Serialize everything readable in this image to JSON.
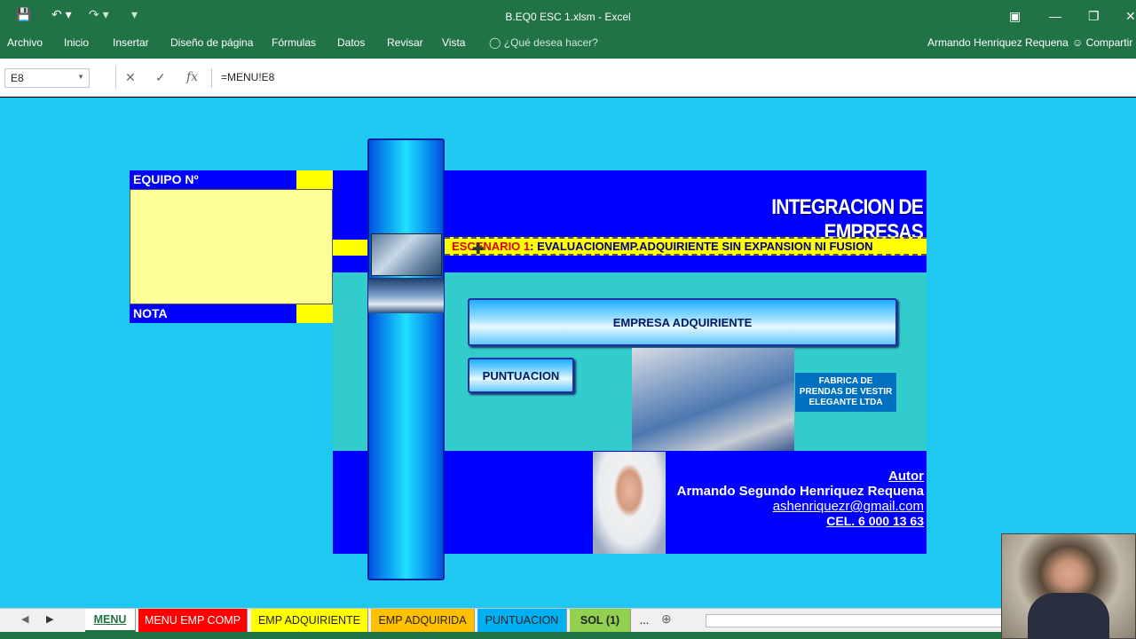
{
  "window": {
    "title": "B.EQ0 ESC 1.xlsm - Excel",
    "user": "Armando Henriquez Requena",
    "share": "Compartir"
  },
  "ribbon": {
    "tabs": [
      "Archivo",
      "Inicio",
      "Insertar",
      "Diseño de página",
      "Fórmulas",
      "Datos",
      "Revisar",
      "Vista"
    ],
    "tell_me": "¿Qué desea hacer?"
  },
  "formula_bar": {
    "name_box": "E8",
    "formula": "=MENU!E8"
  },
  "sheet": {
    "team_label": "EQUIPO Nº",
    "note_label": "NOTA",
    "title": "INTEGRACION DE EMPRESAS",
    "scenario_prefix": "ESCENARIO 1",
    "scenario_text": ": EVALUACIONEMP.ADQUIRIENTE SIN EXPANSION NI FUSION",
    "btn_empresa": "EMPRESA ADQUIRIENTE",
    "btn_puntuacion": "PUNTUACION",
    "factory_label": "FABRICA DE PRENDAS DE VESTIR ELEGANTE LTDA",
    "author_label": "Autor",
    "author_name": "Armando Segundo Henriquez Requena",
    "author_email": "ashenriquezr@gmail.com",
    "author_cel": "CEL. 6  000 13 63"
  },
  "sheet_tabs": [
    {
      "label": "MENU",
      "color": "#ffffff"
    },
    {
      "label": "MENU EMP COMP",
      "color": "#ff0000"
    },
    {
      "label": "EMP ADQUIRIENTE",
      "color": "#ffff00"
    },
    {
      "label": "EMP ADQUIRIDA",
      "color": "#ffc000"
    },
    {
      "label": "PUNTUACION",
      "color": "#00b0f0"
    },
    {
      "label": "SOL (1)",
      "color": "#92d050"
    },
    {
      "label": "...",
      "color": "#f0f0f0"
    }
  ],
  "colors": {
    "excel_green": "#217346",
    "sheet_bg": "#1ec8f0",
    "panel_blue": "#0000ff",
    "panel_teal": "#33cccc",
    "highlight_yellow": "#ffff00"
  }
}
